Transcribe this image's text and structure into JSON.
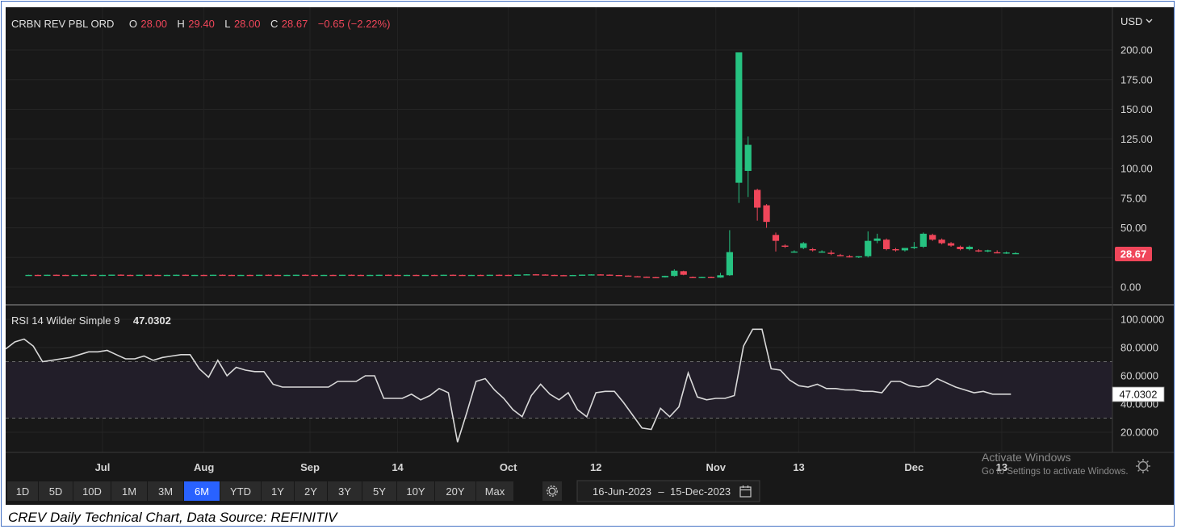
{
  "header": {
    "symbol": "CRBN REV PBL ORD",
    "o_label": "O",
    "o_value": "28.00",
    "h_label": "H",
    "h_value": "29.40",
    "l_label": "L",
    "l_value": "28.00",
    "c_label": "C",
    "c_value": "28.67",
    "change": "−0.65 (−2.22%)"
  },
  "currency_label": "USD",
  "price_badge": "28.67",
  "rsi_badge": "47.0302",
  "rsi_header": {
    "label": "RSI 14 Wilder Simple 9",
    "value": "47.0302"
  },
  "range_buttons": [
    "1D",
    "5D",
    "10D",
    "1M",
    "3M",
    "6M",
    "YTD",
    "1Y",
    "2Y",
    "3Y",
    "5Y",
    "10Y",
    "20Y",
    "Max"
  ],
  "active_range": "6M",
  "date_range": {
    "start": "16-Jun-2023",
    "separator": "–",
    "end": "15-Dec-2023"
  },
  "watermark": {
    "line1": "Activate Windows",
    "line2": "Go to Settings to activate Windows."
  },
  "caption": "CREV Daily Technical Chart, Data Source: REFINITIV",
  "colors": {
    "up": "#26c281",
    "down": "#f0465a",
    "background": "#181818",
    "rsi_line": "#d9d9d9",
    "rsi_band": "#221e29",
    "active_button": "#2962ff"
  },
  "chart_data": [
    {
      "type": "candlestick",
      "x_ticks": [
        "Jul",
        "Aug",
        "Sep",
        "14",
        "Oct",
        "12",
        "Nov",
        "13",
        "Dec",
        "13"
      ],
      "y_ticks": [
        "200.00",
        "175.00",
        "150.00",
        "125.00",
        "100.00",
        "75.00",
        "50.00",
        "25.00",
        "0.00"
      ],
      "y_tick_values": [
        200,
        175,
        150,
        125,
        100,
        75,
        50,
        25,
        0
      ],
      "ylim": [
        -12,
        210
      ],
      "n_slots": 120,
      "x_tick_slots": [
        10.5,
        21.5,
        33,
        42.5,
        54.5,
        64,
        77,
        86,
        98.5,
        108
      ],
      "candles": [
        [
          2,
          10.2,
          10.4,
          10.0,
          10.3
        ],
        [
          3,
          10.3,
          10.5,
          10.1,
          10.2
        ],
        [
          4,
          10.2,
          10.4,
          10.0,
          10.4
        ],
        [
          5,
          10.4,
          10.6,
          10.2,
          10.3
        ],
        [
          6,
          10.3,
          10.5,
          10.1,
          10.2
        ],
        [
          7,
          10.2,
          10.4,
          10.0,
          10.3
        ],
        [
          8,
          10.3,
          10.5,
          10.1,
          10.4
        ],
        [
          9,
          10.4,
          10.6,
          10.2,
          10.2
        ],
        [
          10,
          10.2,
          10.4,
          10.0,
          10.3
        ],
        [
          11,
          10.3,
          10.5,
          10.1,
          10.5
        ],
        [
          12,
          10.5,
          10.7,
          10.3,
          10.3
        ],
        [
          13,
          10.3,
          10.5,
          10.1,
          10.2
        ],
        [
          14,
          10.2,
          10.4,
          10.0,
          10.4
        ],
        [
          15,
          10.4,
          10.6,
          10.2,
          10.3
        ],
        [
          16,
          10.3,
          10.5,
          10.1,
          10.2
        ],
        [
          17,
          10.2,
          10.4,
          10.0,
          10.3
        ],
        [
          18,
          10.3,
          10.5,
          10.1,
          10.4
        ],
        [
          19,
          10.4,
          10.6,
          10.2,
          10.2
        ],
        [
          20,
          10.2,
          10.4,
          10.0,
          10.3
        ],
        [
          21,
          10.3,
          10.5,
          10.1,
          10.2
        ],
        [
          22,
          10.2,
          10.4,
          10.0,
          10.4
        ],
        [
          23,
          10.4,
          10.6,
          10.2,
          10.3
        ],
        [
          24,
          10.3,
          10.5,
          10.1,
          10.2
        ],
        [
          25,
          10.2,
          10.4,
          10.0,
          10.3
        ],
        [
          26,
          10.3,
          10.5,
          10.1,
          10.2
        ],
        [
          27,
          10.2,
          10.4,
          10.0,
          10.4
        ],
        [
          28,
          10.4,
          10.6,
          10.2,
          10.3
        ],
        [
          29,
          10.3,
          10.5,
          10.1,
          10.2
        ],
        [
          30,
          10.2,
          10.4,
          10.0,
          10.3
        ],
        [
          31,
          10.3,
          10.5,
          10.1,
          10.4
        ],
        [
          32,
          10.4,
          10.6,
          10.2,
          10.3
        ],
        [
          33,
          10.3,
          10.5,
          10.1,
          10.2
        ],
        [
          34,
          10.2,
          10.4,
          10.0,
          10.3
        ],
        [
          35,
          10.3,
          10.5,
          10.1,
          10.2
        ],
        [
          36,
          10.2,
          10.4,
          10.0,
          10.4
        ],
        [
          37,
          10.4,
          10.6,
          10.2,
          10.3
        ],
        [
          38,
          10.3,
          10.5,
          10.1,
          10.2
        ],
        [
          39,
          10.2,
          10.4,
          10.0,
          10.3
        ],
        [
          40,
          10.3,
          10.5,
          10.1,
          10.4
        ],
        [
          41,
          10.4,
          10.6,
          10.2,
          10.3
        ],
        [
          42,
          10.3,
          10.5,
          10.1,
          10.2
        ],
        [
          43,
          10.2,
          10.4,
          10.0,
          10.3
        ],
        [
          44,
          10.3,
          10.5,
          10.1,
          10.2
        ],
        [
          45,
          10.2,
          10.4,
          10.0,
          10.3
        ],
        [
          46,
          10.3,
          10.5,
          10.1,
          10.2
        ],
        [
          47,
          10.2,
          10.4,
          10.0,
          10.4
        ],
        [
          48,
          10.4,
          10.6,
          10.2,
          10.3
        ],
        [
          49,
          10.3,
          10.5,
          10.1,
          10.2
        ],
        [
          50,
          10.2,
          10.4,
          10.0,
          10.3
        ],
        [
          51,
          10.3,
          10.5,
          10.1,
          10.2
        ],
        [
          52,
          10.2,
          10.4,
          10.0,
          10.4
        ],
        [
          53,
          10.4,
          10.6,
          10.2,
          10.3
        ],
        [
          54,
          10.3,
          10.5,
          10.1,
          10.2
        ],
        [
          55,
          10.2,
          10.6,
          10.0,
          10.5
        ],
        [
          56,
          10.5,
          10.9,
          10.3,
          10.8
        ],
        [
          57,
          10.8,
          11.0,
          10.4,
          10.6
        ],
        [
          58,
          10.6,
          10.8,
          10.2,
          10.3
        ],
        [
          59,
          10.3,
          10.5,
          10.0,
          10.1
        ],
        [
          60,
          10.1,
          10.3,
          9.8,
          9.9
        ],
        [
          61,
          9.9,
          10.3,
          9.8,
          10.2
        ],
        [
          62,
          10.2,
          10.6,
          10.0,
          10.5
        ],
        [
          63,
          10.5,
          10.8,
          10.3,
          10.7
        ],
        [
          64,
          10.7,
          10.9,
          10.4,
          10.5
        ],
        [
          65,
          10.5,
          10.7,
          10.1,
          10.2
        ],
        [
          66,
          10.2,
          10.3,
          9.6,
          9.7
        ],
        [
          67,
          9.7,
          9.8,
          9.0,
          9.1
        ],
        [
          68,
          9.1,
          9.3,
          8.6,
          8.7
        ],
        [
          69,
          8.7,
          8.9,
          8.3,
          8.4
        ],
        [
          70,
          8.4,
          8.6,
          8.0,
          8.2
        ],
        [
          71,
          8.2,
          9.6,
          8.0,
          9.4
        ],
        [
          72,
          9.4,
          15,
          8.8,
          13.8
        ],
        [
          73,
          13.4,
          13.8,
          10.0,
          10.4
        ],
        [
          74,
          8.5,
          8.9,
          8.0,
          8.3
        ],
        [
          75,
          8.3,
          8.7,
          7.9,
          8.5
        ],
        [
          76,
          8.5,
          8.8,
          8.1,
          8.2
        ],
        [
          77,
          8.0,
          12,
          7.8,
          10.0
        ],
        [
          78,
          10.0,
          48,
          9.5,
          29.5
        ],
        [
          79,
          88,
          198,
          71,
          198
        ],
        [
          80,
          98,
          127,
          76,
          120
        ],
        [
          81,
          82,
          83,
          56,
          67
        ],
        [
          82,
          69,
          70,
          50,
          55
        ],
        [
          83,
          44,
          46,
          30,
          39
        ],
        [
          84,
          35,
          36,
          33,
          34
        ],
        [
          85,
          30,
          31,
          29,
          30
        ],
        [
          86,
          33,
          38,
          32,
          37
        ],
        [
          87,
          32,
          33,
          30,
          31
        ],
        [
          88,
          30,
          31,
          29,
          30
        ],
        [
          89,
          29,
          31,
          27,
          28
        ],
        [
          90,
          27,
          28,
          26,
          26.5
        ],
        [
          91,
          26,
          27,
          25,
          25.5
        ],
        [
          92,
          25.5,
          26,
          24.5,
          26
        ],
        [
          93,
          26,
          47,
          25,
          39
        ],
        [
          94,
          39,
          45,
          37,
          41
        ],
        [
          95,
          40,
          41,
          31,
          32
        ],
        [
          96,
          32,
          33,
          30,
          31
        ],
        [
          97,
          31,
          33,
          30,
          33
        ],
        [
          98,
          33,
          38,
          32,
          34
        ],
        [
          99,
          34,
          46,
          33,
          45
        ],
        [
          100,
          44,
          45,
          39,
          40
        ],
        [
          101,
          40,
          41,
          36,
          37
        ],
        [
          102,
          37,
          38,
          34,
          35
        ],
        [
          103,
          34,
          35,
          31,
          32
        ],
        [
          104,
          32,
          35,
          31,
          34
        ],
        [
          105,
          31,
          32,
          29.5,
          30.5
        ],
        [
          106,
          30.5,
          31.5,
          29.4,
          31
        ],
        [
          107,
          29.4,
          31,
          28.5,
          28.8
        ],
        [
          108,
          28.8,
          30,
          28,
          29.2
        ],
        [
          109,
          28,
          29.4,
          28,
          28.67
        ]
      ]
    },
    {
      "type": "line",
      "title": "RSI 14 Wilder Simple 9",
      "y_ticks": [
        "100.0000",
        "80.0000",
        "60.0000",
        "40.0000",
        "20.0000"
      ],
      "y_tick_values": [
        100,
        80,
        60,
        40,
        20
      ],
      "ylim": [
        10,
        102
      ],
      "band": [
        30,
        70
      ],
      "series": [
        {
          "values": [
            [
              0,
              79
            ],
            [
              1,
              84
            ],
            [
              2,
              86
            ],
            [
              3,
              81
            ],
            [
              4,
              70
            ],
            [
              5,
              71
            ],
            [
              6,
              72
            ],
            [
              7,
              73
            ],
            [
              8,
              75
            ],
            [
              9,
              77
            ],
            [
              10,
              77
            ],
            [
              11,
              78
            ],
            [
              12,
              75
            ],
            [
              13,
              72
            ],
            [
              14,
              72
            ],
            [
              15,
              74
            ],
            [
              16,
              71
            ],
            [
              17,
              73
            ],
            [
              18,
              74
            ],
            [
              19,
              75
            ],
            [
              20,
              75
            ],
            [
              21,
              65
            ],
            [
              22,
              59
            ],
            [
              23,
              71
            ],
            [
              24,
              60
            ],
            [
              25,
              66
            ],
            [
              26,
              64
            ],
            [
              27,
              63
            ],
            [
              28,
              63
            ],
            [
              29,
              54
            ],
            [
              30,
              52
            ],
            [
              31,
              52
            ],
            [
              32,
              52
            ],
            [
              33,
              52
            ],
            [
              34,
              52
            ],
            [
              35,
              52
            ],
            [
              36,
              56
            ],
            [
              37,
              56
            ],
            [
              38,
              56
            ],
            [
              39,
              60
            ],
            [
              40,
              60
            ],
            [
              41,
              44
            ],
            [
              42,
              44
            ],
            [
              43,
              44
            ],
            [
              44,
              47
            ],
            [
              45,
              43
            ],
            [
              46,
              46
            ],
            [
              47,
              51
            ],
            [
              48,
              48
            ],
            [
              49,
              13
            ],
            [
              50,
              34
            ],
            [
              51,
              56
            ],
            [
              52,
              58
            ],
            [
              53,
              50
            ],
            [
              54,
              44
            ],
            [
              55,
              36
            ],
            [
              56,
              31
            ],
            [
              57,
              46
            ],
            [
              58,
              54
            ],
            [
              59,
              47
            ],
            [
              60,
              43
            ],
            [
              61,
              48
            ],
            [
              62,
              36
            ],
            [
              63,
              31
            ],
            [
              64,
              48
            ],
            [
              65,
              49
            ],
            [
              66,
              49
            ],
            [
              67,
              41
            ],
            [
              68,
              32
            ],
            [
              69,
              23
            ],
            [
              70,
              22
            ],
            [
              71,
              37
            ],
            [
              72,
              31
            ],
            [
              73,
              38
            ],
            [
              74,
              62
            ],
            [
              75,
              45
            ],
            [
              76,
              43
            ],
            [
              77,
              44
            ],
            [
              78,
              44
            ],
            [
              79,
              46
            ],
            [
              80,
              81
            ],
            [
              81,
              93
            ],
            [
              82,
              93
            ],
            [
              83,
              65
            ],
            [
              84,
              64
            ],
            [
              85,
              57
            ],
            [
              86,
              53
            ],
            [
              87,
              52
            ],
            [
              88,
              54
            ],
            [
              89,
              51
            ],
            [
              90,
              51
            ],
            [
              91,
              50
            ],
            [
              92,
              50
            ],
            [
              93,
              49
            ],
            [
              94,
              49
            ],
            [
              95,
              48
            ],
            [
              96,
              56
            ],
            [
              97,
              56
            ],
            [
              98,
              53
            ],
            [
              99,
              52
            ],
            [
              100,
              53
            ],
            [
              101,
              58
            ],
            [
              102,
              55
            ],
            [
              103,
              52
            ],
            [
              104,
              50
            ],
            [
              105,
              48
            ],
            [
              106,
              49
            ],
            [
              107,
              47
            ],
            [
              108,
              47
            ],
            [
              109,
              47
            ]
          ]
        }
      ]
    }
  ]
}
